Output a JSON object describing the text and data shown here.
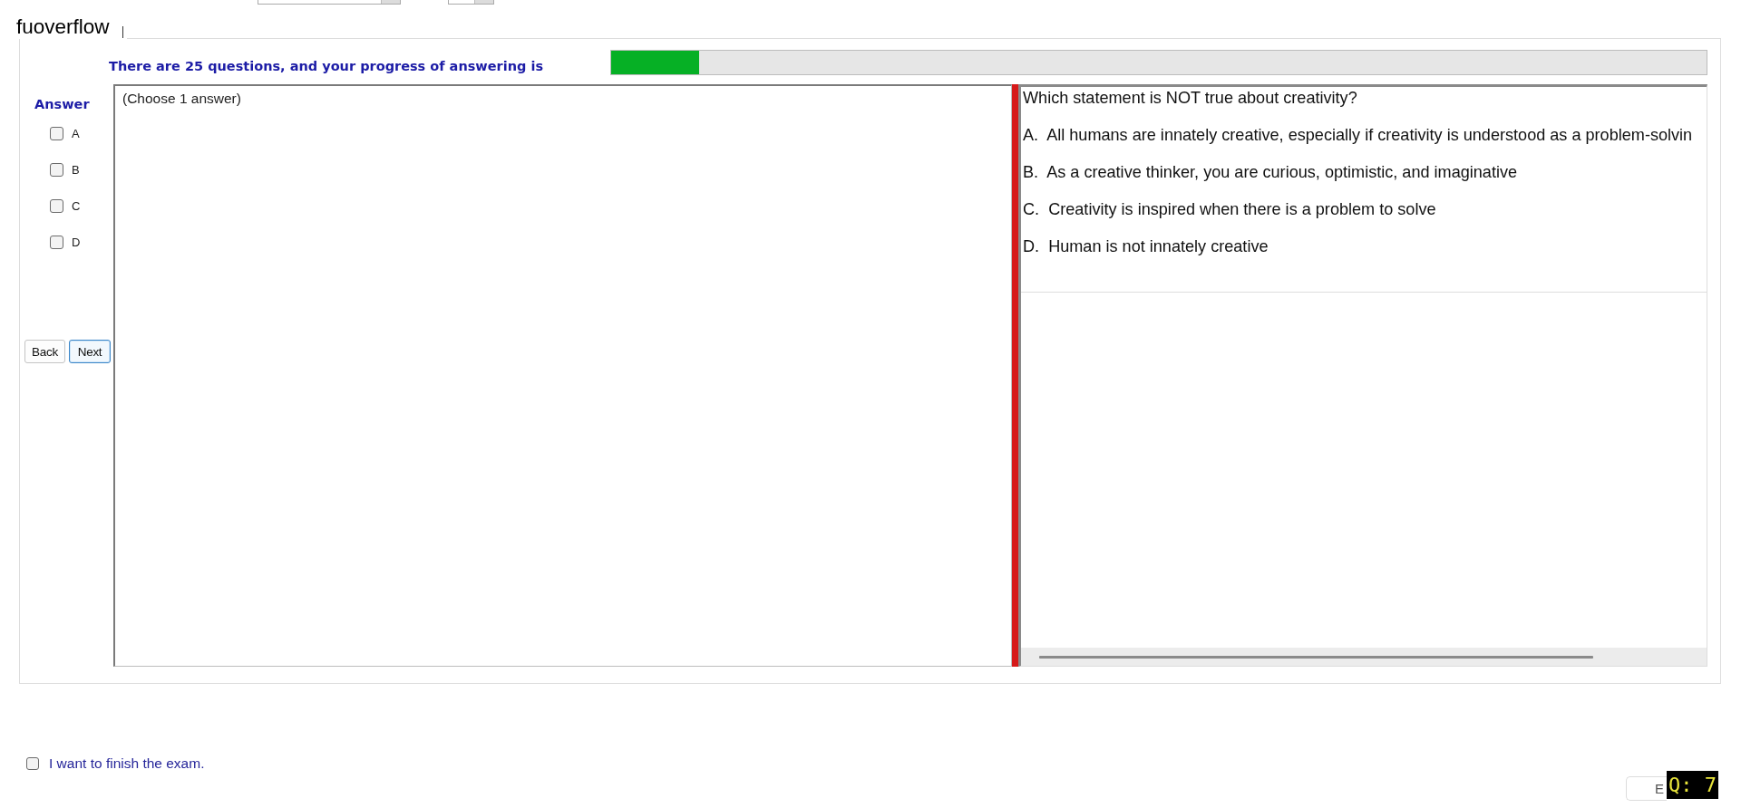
{
  "top_controls": [
    {
      "kind": "dropdown"
    },
    {
      "kind": "dropdown"
    }
  ],
  "group": {
    "caption": "fuoverflow"
  },
  "progress": {
    "label": "There are 25 questions, and your progress of answering is",
    "level": 0.08
  },
  "answer_panel": {
    "title": "Answer",
    "choices": [
      {
        "label": "A",
        "checked": false
      },
      {
        "label": "B",
        "checked": false
      },
      {
        "label": "C",
        "checked": false
      },
      {
        "label": "D",
        "checked": false
      }
    ],
    "buttons": [
      {
        "label": "Back",
        "focused": false
      },
      {
        "label": "Next",
        "focused": true
      }
    ]
  },
  "answer_box": {
    "instruction": "(Choose 1 answer)"
  },
  "question": {
    "text": "Which statement is NOT true about creativity?",
    "options": [
      "A.  All humans are innately creative, especially if creativity is understood as a problem-solvin",
      "B.  As a creative thinker, you are curious, optimistic, and imaginative",
      "C.  Creativity is inspired when there is a problem to solve",
      "D.  Human is not innately creative"
    ]
  },
  "footer": {
    "finish": {
      "label": "I want to finish the exam.",
      "checked": false
    },
    "exit_button": {
      "label": "E"
    },
    "question_badge": "Q: 7"
  }
}
